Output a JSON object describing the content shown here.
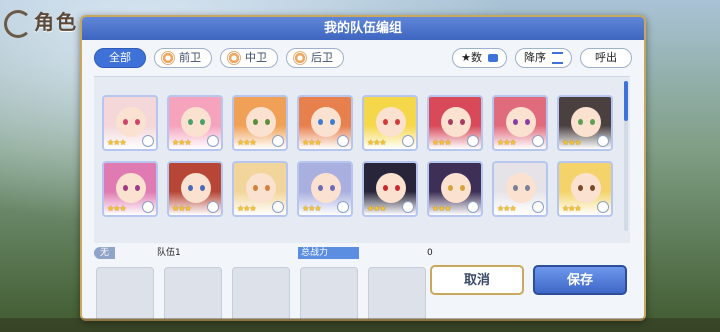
{
  "background": {
    "title": "角色"
  },
  "dialog": {
    "title": "我的队伍编组",
    "filters": [
      {
        "label": "全部",
        "active": true
      },
      {
        "label": "前卫",
        "active": false
      },
      {
        "label": "中卫",
        "active": false
      },
      {
        "label": "后卫",
        "active": false
      }
    ],
    "sort": {
      "key_label": "★数",
      "order_label": "降序",
      "call_label": "呼出"
    },
    "characters_row1": [
      {
        "stars": "★★★",
        "hair": "#f3d7d9",
        "eye": "#d0436a",
        "frame": "#b6c6ee"
      },
      {
        "stars": "★★★",
        "hair": "#f6a3be",
        "eye": "#4aa06c",
        "frame": "#b6c6ee"
      },
      {
        "stars": "★★★",
        "hair": "#f0a157",
        "eye": "#5a8f3a",
        "frame": "#b6c6ee"
      },
      {
        "stars": "★★★",
        "hair": "#e8804e",
        "eye": "#3b7dd1",
        "frame": "#b6c6ee"
      },
      {
        "stars": "★★★",
        "hair": "#f5d74a",
        "eye": "#cf3b3b",
        "frame": "#b6c6ee"
      },
      {
        "stars": "★★★",
        "hair": "#d8495a",
        "eye": "#a53a62",
        "frame": "#b6c6ee"
      },
      {
        "stars": "★★★",
        "hair": "#e06b7c",
        "eye": "#8a3ea4",
        "frame": "#b6c6ee"
      },
      {
        "stars": "★★★",
        "hair": "#4a4040",
        "eye": "#5aa050",
        "frame": "#b6c6ee"
      }
    ],
    "characters_row2": [
      {
        "stars": "★★★",
        "hair": "#e07ab2",
        "eye": "#9d3b87",
        "frame": "#b6c6ee"
      },
      {
        "stars": "★★★",
        "hair": "#b84636",
        "eye": "#4a6ab8",
        "frame": "#b6c6ee"
      },
      {
        "stars": "★★★",
        "hair": "#f2d59a",
        "eye": "#d2813a",
        "frame": "#b6c6ee"
      },
      {
        "stars": "★★★",
        "hair": "#a9b0df",
        "eye": "#6e6ab8",
        "frame": "#b6c6ee"
      },
      {
        "stars": "★★★",
        "hair": "#28253a",
        "eye": "#c9262f",
        "frame": "#b6c6ee"
      },
      {
        "stars": "★★★",
        "hair": "#3d2f55",
        "eye": "#d9a23a",
        "frame": "#b6c6ee"
      },
      {
        "stars": "★★★",
        "hair": "#e5e3e8",
        "eye": "#7a7f9a",
        "frame": "#b6c6ee"
      },
      {
        "stars": "★★★",
        "hair": "#f4d46a",
        "eye": "#7a4a28",
        "frame": "#b6c6ee"
      }
    ],
    "team": {
      "tag": "无",
      "name": "队伍1",
      "power_label": "总战力",
      "power_value": "0"
    },
    "buttons": {
      "cancel": "取消",
      "save": "保存"
    },
    "colors": {
      "accent": "#3f72d8",
      "gold_border": "#c9a75c"
    }
  }
}
